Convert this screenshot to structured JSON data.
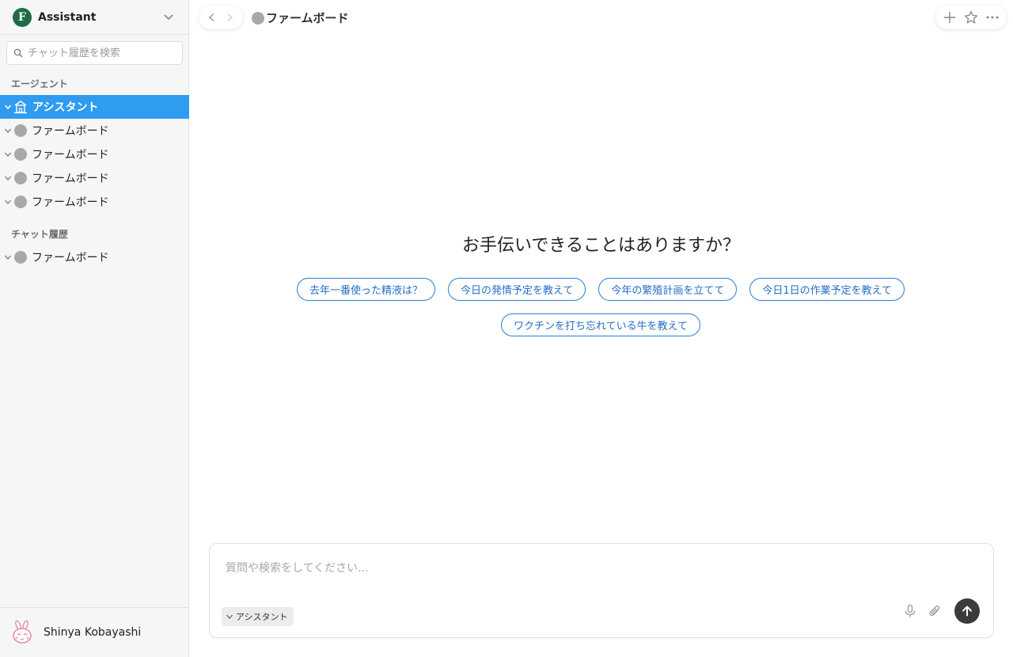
{
  "workspace": {
    "logo_letter": "F",
    "name": "Assistant",
    "brand_color": "#1f6b45"
  },
  "search": {
    "placeholder": "チャット履歴を検索"
  },
  "sections": {
    "agents_label": "エージェント",
    "history_label": "チャット履歴"
  },
  "agents": [
    {
      "label": "アシスタント",
      "icon": "building-icon",
      "active": true
    },
    {
      "label": "ファームボード",
      "icon": "gray-dot"
    },
    {
      "label": "ファームボード",
      "icon": "gray-dot"
    },
    {
      "label": "ファームボード",
      "icon": "gray-dot"
    },
    {
      "label": "ファームボード",
      "icon": "gray-dot"
    }
  ],
  "history": [
    {
      "label": "ファームボード",
      "icon": "gray-dot"
    }
  ],
  "user": {
    "name": "Shinya Kobayashi"
  },
  "header": {
    "title": "ファームボード"
  },
  "main": {
    "greeting": "お手伝いできることはありますか？",
    "suggestions": [
      "去年一番使った精液は？",
      "今日の発情予定を教えて",
      "今年の繁殖計画を立てて",
      "今日1日の作業予定を教えて",
      "ワクチンを打ち忘れている牛を教えて"
    ]
  },
  "composer": {
    "placeholder": "質問や検索をしてください...",
    "agent_label": "アシスタント"
  },
  "colors": {
    "active_item": "#2f9cf0",
    "chip_border": "#2b7fd0",
    "send_button": "#3b3b3b"
  }
}
